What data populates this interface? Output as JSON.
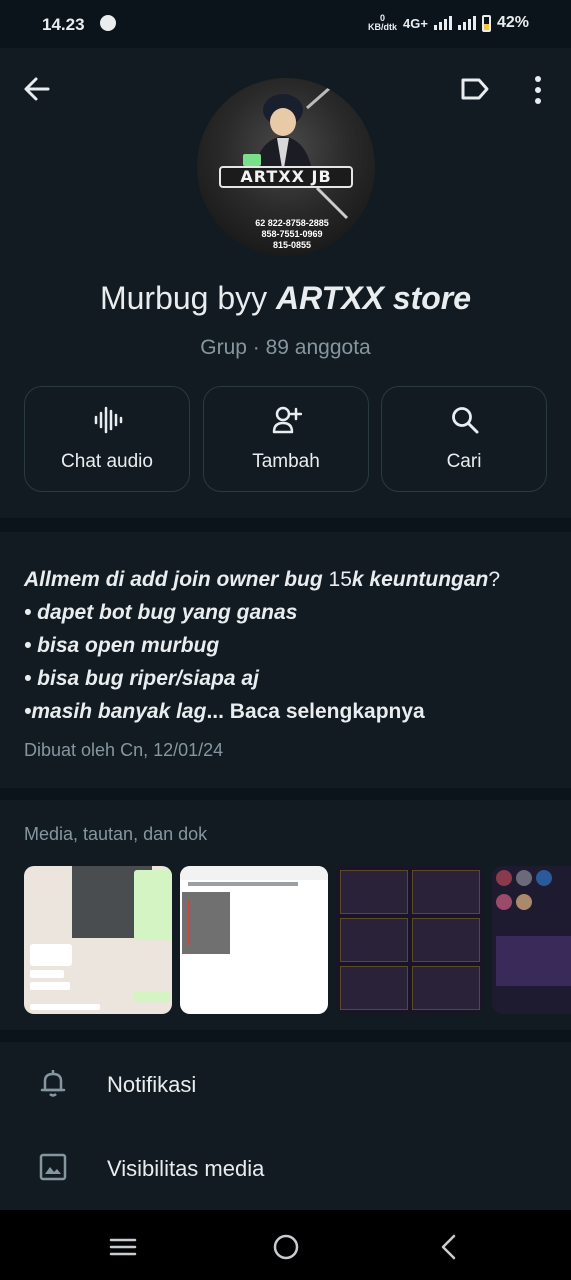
{
  "status": {
    "time": "14.23",
    "speed_value": "0",
    "speed_unit": "KB/dtk",
    "network": "4G+",
    "battery": "42%"
  },
  "group": {
    "title_regular": "Murbug byy ",
    "title_bold": "ARTXX store",
    "subtitle": "Grup · 89 anggota",
    "avatar_brand": "ARTXX JB",
    "avatar_phones": [
      "62 822-8758-2885",
      "858-7551-0969",
      "815-0855"
    ]
  },
  "actions": [
    {
      "label": "Chat audio",
      "icon": "audio-wave-icon"
    },
    {
      "label": "Tambah",
      "icon": "add-person-icon"
    },
    {
      "label": "Cari",
      "icon": "search-icon"
    }
  ],
  "description": {
    "line1_a": "Allmem di add join owner bug ",
    "line1_b": "15",
    "line1_c": "k keuntungan",
    "line1_d": "?",
    "line2": "• dapet bot bug yang ganas",
    "line3": "• bisa open murbug",
    "line4": "• bisa bug riper/siapa aj",
    "line5_a": "•masih banyak lag",
    "line5_b": "... Baca selengkapnya",
    "meta": "Dibuat oleh Cn, 12/01/24"
  },
  "media": {
    "title": "Media, tautan, dan dok"
  },
  "settings": [
    {
      "label": "Notifikasi",
      "icon": "bell-icon"
    },
    {
      "label": "Visibilitas media",
      "icon": "image-icon"
    }
  ],
  "colors": {
    "background": "#0b141a",
    "panel": "#111b21",
    "text_primary": "#e9edef",
    "text_secondary": "#8696a0"
  }
}
